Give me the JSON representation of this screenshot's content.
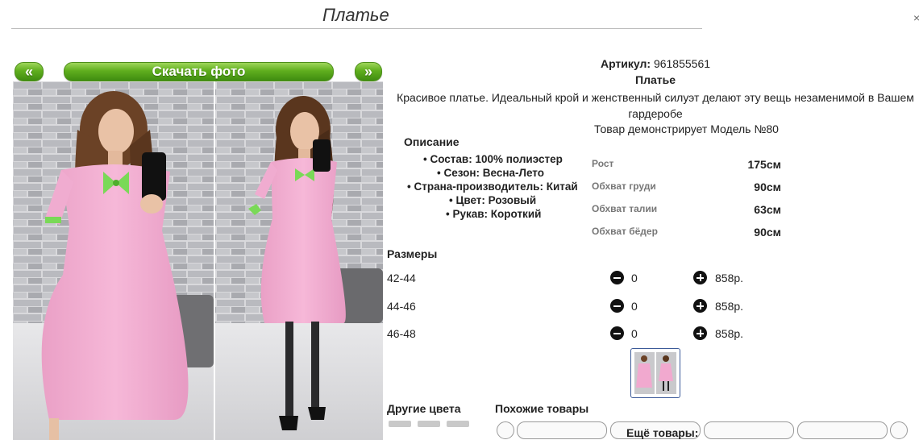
{
  "header": {
    "title": "Платье",
    "close": "×"
  },
  "gallery": {
    "prev_label": "«",
    "next_label": "»",
    "download_label": "Скачать фото"
  },
  "product": {
    "article_label": "Артикул:",
    "article_value": "961855561",
    "name": "Платье",
    "description": "Красивое платье. Идеальный крой и женственный силуэт делают эту вещь незаменимой в Вашем гардеробе",
    "model_line": "Товар демонстрирует Модель №80"
  },
  "specs": {
    "heading": "Описание",
    "items": [
      "Состав: 100% полиэстер",
      "Сезон: Весна-Лето",
      "Страна-производитель: Китай",
      "Цвет: Розовый",
      "Рукав: Короткий"
    ]
  },
  "measurements": [
    {
      "label": "Рост",
      "value": "175см"
    },
    {
      "label": "Обхват груди",
      "value": "90см"
    },
    {
      "label": "Обхват талии",
      "value": "63см"
    },
    {
      "label": "Обхват бёдер",
      "value": "90см"
    }
  ],
  "sizes": {
    "heading": "Размеры",
    "rows": [
      {
        "size": "42-44",
        "qty": "0",
        "price": "858р."
      },
      {
        "size": "44-46",
        "qty": "0",
        "price": "858р."
      },
      {
        "size": "46-48",
        "qty": "0",
        "price": "858р."
      }
    ]
  },
  "footer": {
    "other_colors": "Другие цвета",
    "similar": "Похожие товары",
    "more": "Ещё товары:"
  },
  "colors": {
    "accent_green": "#5fae1e",
    "dress_pink": "#f1a9cf",
    "bow_green": "#7ad957"
  }
}
